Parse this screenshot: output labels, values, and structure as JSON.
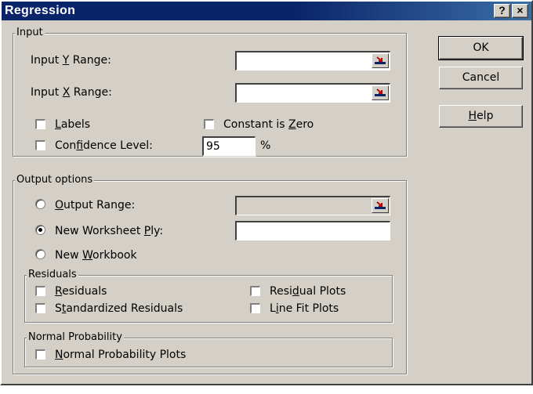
{
  "window": {
    "title": "Regression"
  },
  "titlebar": {
    "help_label": "?",
    "close_label": "×"
  },
  "input": {
    "legend": "Input",
    "y_range": {
      "pre": "Input ",
      "key": "Y",
      "post": " Range:",
      "value": ""
    },
    "x_range": {
      "pre": "Input ",
      "key": "X",
      "post": " Range:",
      "value": ""
    },
    "labels": {
      "pre": "",
      "key": "L",
      "post": "abels",
      "checked": false
    },
    "constant_zero": {
      "pre": "Constant is ",
      "key": "Z",
      "post": "ero",
      "checked": false
    },
    "confidence": {
      "pre": "Con",
      "key": "f",
      "post": "idence Level:",
      "checked": false,
      "value": "95",
      "unit": "%"
    }
  },
  "output": {
    "legend": "Output options",
    "output_range": {
      "pre": "",
      "key": "O",
      "post": "utput Range:",
      "selected": false,
      "value": ""
    },
    "new_worksheet": {
      "pre": "New Worksheet ",
      "key": "P",
      "post": "ly:",
      "selected": true,
      "value": ""
    },
    "new_workbook": {
      "pre": "New ",
      "key": "W",
      "post": "orkbook",
      "selected": false
    },
    "residuals_group": {
      "legend": "Residuals",
      "residuals": {
        "pre": "",
        "key": "R",
        "post": "esiduals",
        "checked": false
      },
      "standardized": {
        "pre": "S",
        "key": "t",
        "post": "andardized Residuals",
        "checked": false
      },
      "residual_plots": {
        "pre": "Resi",
        "key": "d",
        "post": "ual Plots",
        "checked": false
      },
      "line_fit": {
        "pre": "L",
        "key": "i",
        "post": "ne Fit Plots",
        "checked": false
      }
    },
    "normal_group": {
      "legend": "Normal Probability",
      "normal_plots": {
        "pre": "",
        "key": "N",
        "post": "ormal Probability Plots",
        "checked": false
      }
    }
  },
  "buttons": {
    "ok": "OK",
    "cancel": "Cancel",
    "help": {
      "pre": "",
      "key": "H",
      "post": "elp"
    }
  }
}
